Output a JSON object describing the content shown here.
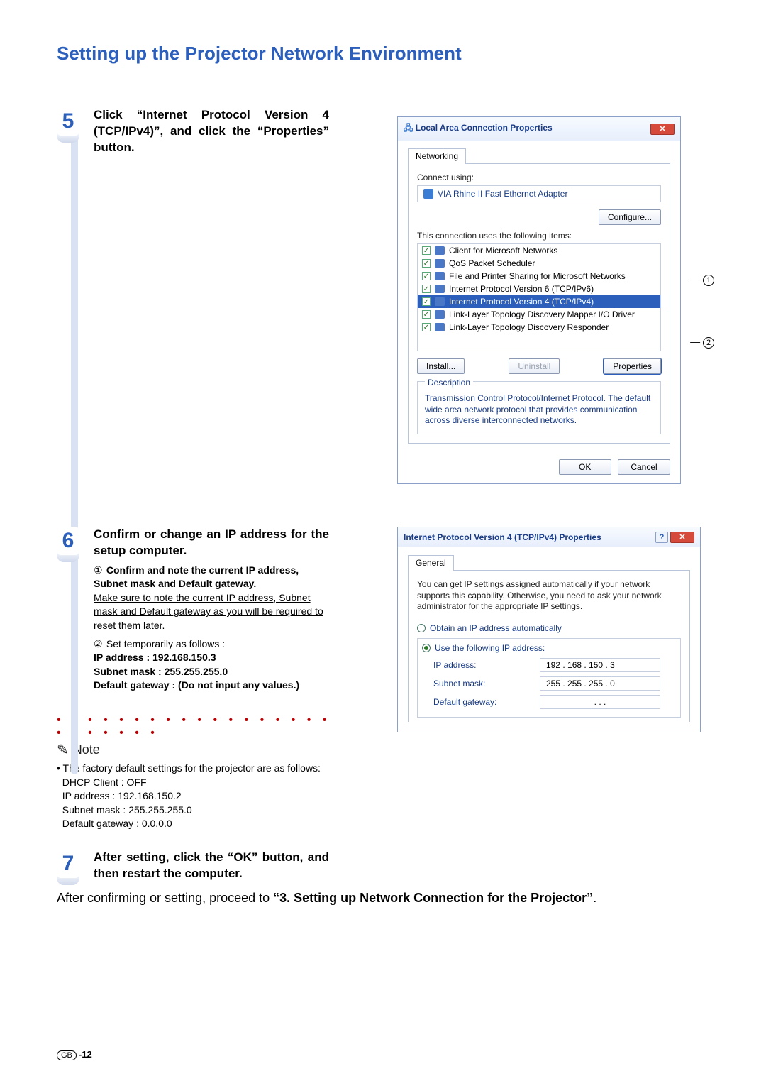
{
  "title": "Setting up the Projector Network Environment",
  "steps": {
    "s5": {
      "num": "5",
      "head": "Click “Internet Protocol Version 4 (TCP/IPv4)”, and click the “Properties” button."
    },
    "s6": {
      "num": "6",
      "head": "Confirm or change an IP address for the setup computer.",
      "n1": "①",
      "item1_head": "Confirm and note the current IP address, Subnet mask and Default gateway.",
      "item1_note": "Make sure to note the current IP address, Subnet mask and Default gateway as you will be required to reset them later.",
      "n2": "②",
      "item2_head": "Set  temporarily as follows :",
      "ip_label": "IP address : 192.168.150.3",
      "mask_label": "Subnet mask : 255.255.255.0",
      "gw_label": "Default gateway : (Do not input any values.)"
    },
    "s7": {
      "num": "7",
      "head": "After setting, click the “OK” button, and then restart the computer."
    }
  },
  "note": {
    "label": "Note",
    "bullet": "•",
    "intro": "The factory default settings for the projector are as follows:",
    "l1": "DHCP Client : OFF",
    "l2": "IP address : 192.168.150.2",
    "l3": "Subnet mask : 255.255.255.0",
    "l4": "Default gateway : 0.0.0.0"
  },
  "after_pre": "After confirming or setting, proceed to ",
  "after_bold": "“3. Setting up Network Connection for the Projector”",
  "after_post": ".",
  "page": {
    "gb": "GB",
    "num": "-12"
  },
  "win1": {
    "title": "Local Area Connection Properties",
    "tab": "Networking",
    "connect_using": "Connect using:",
    "adapter": "VIA Rhine II Fast Ethernet Adapter",
    "configure": "Configure...",
    "uses": "This connection uses the following items:",
    "items": [
      "Client for Microsoft Networks",
      "QoS Packet Scheduler",
      "File and Printer Sharing for Microsoft Networks",
      "Internet Protocol Version 6 (TCP/IPv6)",
      "Internet Protocol Version 4 (TCP/IPv4)",
      "Link-Layer Topology Discovery Mapper I/O Driver",
      "Link-Layer Topology Discovery Responder"
    ],
    "install": "Install...",
    "uninstall": "Uninstall",
    "properties": "Properties",
    "desc_label": "Description",
    "desc": "Transmission Control Protocol/Internet Protocol. The default wide area network protocol that provides communication across diverse interconnected networks.",
    "ok": "OK",
    "cancel": "Cancel",
    "callout1": "1",
    "callout2": "2"
  },
  "win2": {
    "title": "Internet Protocol Version 4 (TCP/IPv4) Properties",
    "tab": "General",
    "intro": "You can get IP settings assigned automatically if your network supports this capability. Otherwise, you need to ask your network administrator for the appropriate IP settings.",
    "r1": "Obtain an IP address automatically",
    "r2": "Use the following IP address:",
    "k_ip": "IP address:",
    "v_ip": "192 . 168 . 150 .   3",
    "k_mask": "Subnet mask:",
    "v_mask": "255 . 255 . 255 .   0",
    "k_gw": "Default gateway:",
    "v_gw": ".       .       ."
  }
}
